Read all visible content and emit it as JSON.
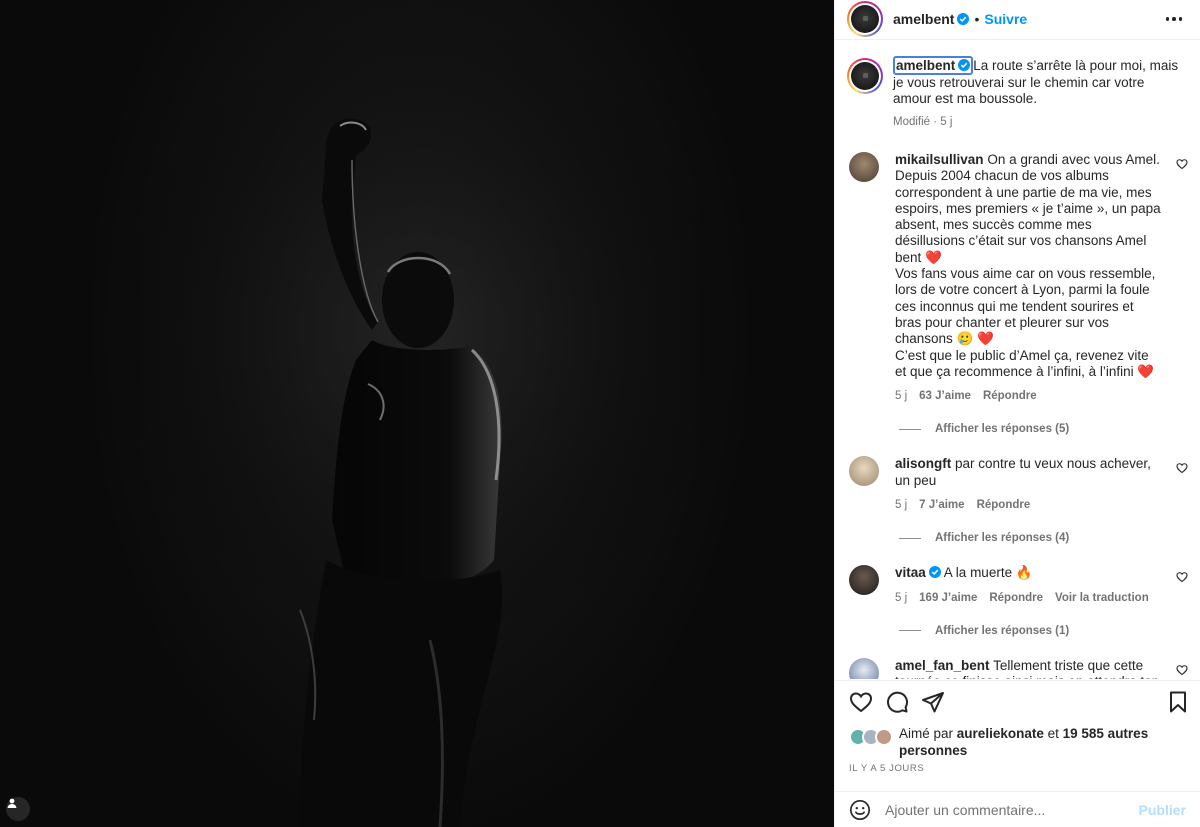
{
  "post": {
    "username": "amelbent",
    "follow_label": "Suivre",
    "separator": "•",
    "caption": "La route s’arrête là pour moi, mais je vous retrouverai sur le chemin car votre amour est ma boussole.",
    "caption_meta": "Modifié · 5 j"
  },
  "comments": [
    {
      "username": "mikailsullivan",
      "text_lines": [
        "On a grandi avec vous Amel. Depuis 2004 chacun de vos albums correspondent à une partie de ma vie, mes espoirs, mes premiers « je t’aime », un papa absent, mes succès comme mes désillusions c’était sur vos chansons Amel bent ❤️",
        "Vos fans vous aime car on vous ressemble, lors de votre concert à Lyon, parmi la foule ces inconnus qui me tendent sourires et bras pour chanter et pleurer sur vos chansons 🥲 ❤️",
        "C’est que le public d’Amel ça, revenez vite et que ça recommence à l’infini, à l’infini ❤️"
      ],
      "time": "5 j",
      "likes": "63 J’aime",
      "reply": "Répondre",
      "view_replies": "Afficher les réponses (5)",
      "avatar_color": "#6b5a48"
    },
    {
      "username": "alisongft",
      "text": "par contre tu veux nous achever, un peu",
      "time": "5 j",
      "likes": "7 J’aime",
      "reply": "Répondre",
      "view_replies": "Afficher les réponses (4)",
      "avatar_color": "#c9b89c"
    },
    {
      "username": "vitaa",
      "text": "A la muerte 🔥",
      "time": "5 j",
      "likes": "169 J’aime",
      "reply": "Répondre",
      "translate": "Voir la traduction",
      "view_replies": "Afficher les réponses (1)",
      "avatar_color": "#2e2a28"
    },
    {
      "username": "amel_fan_bent",
      "text": "Tellement triste que cette tournée ce finisse ainsi mais on attendra ton retour, merci encore pour cette",
      "avatar_color": "#8fa4c8"
    }
  ],
  "likes": {
    "prefix": "Aimé par",
    "user": "aureliekonate",
    "middle": "et",
    "count": "19 585 autres personnes"
  },
  "time_ago": "IL Y A 5 JOURS",
  "composer": {
    "placeholder": "Ajouter un commentaire...",
    "publish": "Publier"
  },
  "colors": {
    "accent": "#0095f6",
    "verified": "#0095f6",
    "muted": "#737373"
  }
}
